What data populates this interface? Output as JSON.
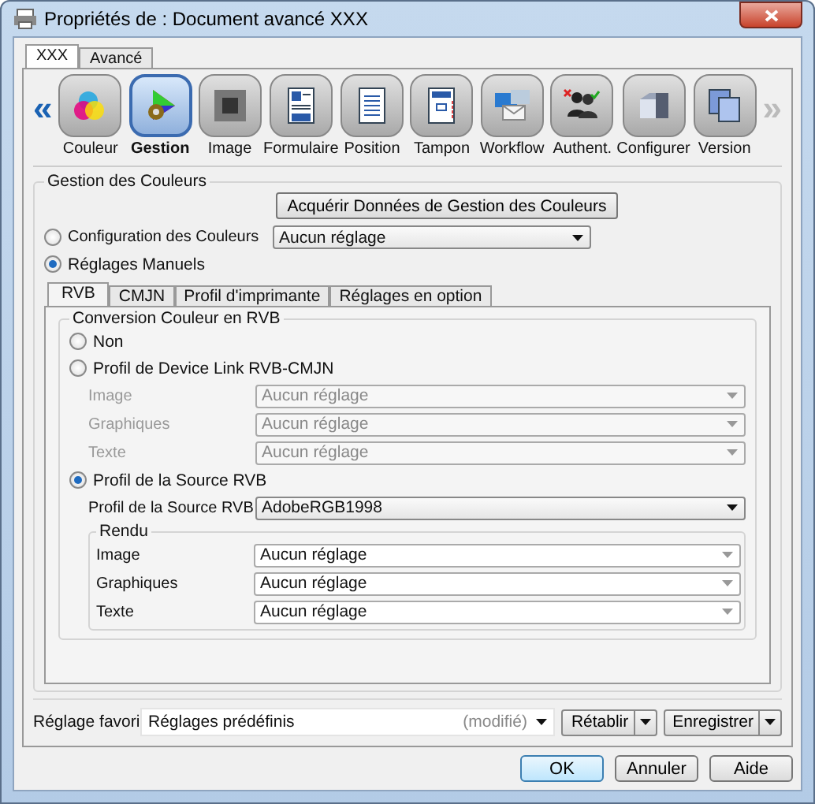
{
  "window": {
    "title": "Propriétés de : Document avancé XXX"
  },
  "tabs": [
    {
      "label": "XXX",
      "selected": true
    },
    {
      "label": "Avancé",
      "selected": false
    }
  ],
  "toolbar": {
    "prev": {
      "label": "«",
      "disabled": false
    },
    "next": {
      "label": "»",
      "disabled": true
    },
    "items": [
      {
        "label": "Couleur",
        "selected": false
      },
      {
        "label": "Gestion",
        "selected": true
      },
      {
        "label": "Image",
        "selected": false
      },
      {
        "label": "Formulaire",
        "selected": false
      },
      {
        "label": "Position",
        "selected": false
      },
      {
        "label": "Tampon",
        "selected": false
      },
      {
        "label": "Workflow",
        "selected": false
      },
      {
        "label": "Authent.",
        "selected": false
      },
      {
        "label": "Configurer",
        "selected": false
      },
      {
        "label": "Version",
        "selected": false
      }
    ]
  },
  "color_management": {
    "title": "Gestion des Couleurs",
    "acquire_button": "Acquérir Données de Gestion des Couleurs",
    "options": [
      {
        "label": "Configuration des Couleurs",
        "selected": false,
        "dropdown": "Aucun réglage"
      },
      {
        "label": "Réglages Manuels",
        "selected": true
      }
    ],
    "subtabs": [
      {
        "label": "RVB",
        "selected": true
      },
      {
        "label": "CMJN",
        "selected": false
      },
      {
        "label": "Profil d'imprimante",
        "selected": false
      },
      {
        "label": "Réglages en option",
        "selected": false
      }
    ],
    "conversion": {
      "title": "Conversion Couleur en RVB",
      "options": [
        {
          "label": "Non",
          "selected": false
        },
        {
          "label": "Profil de Device Link RVB-CMJN",
          "selected": false,
          "fields": [
            {
              "label": "Image",
              "value": "Aucun réglage",
              "disabled": true
            },
            {
              "label": "Graphiques",
              "value": "Aucun réglage",
              "disabled": true
            },
            {
              "label": "Texte",
              "value": "Aucun réglage",
              "disabled": true
            }
          ]
        },
        {
          "label": "Profil de la Source RVB",
          "selected": true,
          "fields": [
            {
              "label": "Profil de la Source RVB",
              "value": "AdobeRGB1998",
              "disabled": false
            }
          ]
        }
      ],
      "rendering": {
        "title": "Rendu",
        "fields": [
          {
            "label": "Image",
            "value": "Aucun réglage",
            "disabled": false
          },
          {
            "label": "Graphiques",
            "value": "Aucun réglage",
            "disabled": false
          },
          {
            "label": "Texte",
            "value": "Aucun réglage",
            "disabled": false
          }
        ]
      }
    }
  },
  "favorite": {
    "label": "Réglage favori",
    "value": "Réglages prédéfinis",
    "note": "(modifié)",
    "buttons": [
      "Rétablir",
      "Enregistrer"
    ]
  },
  "buttons": [
    {
      "label": "OK",
      "default": true
    },
    {
      "label": "Annuler",
      "default": false
    },
    {
      "label": "Aide",
      "default": false
    }
  ]
}
